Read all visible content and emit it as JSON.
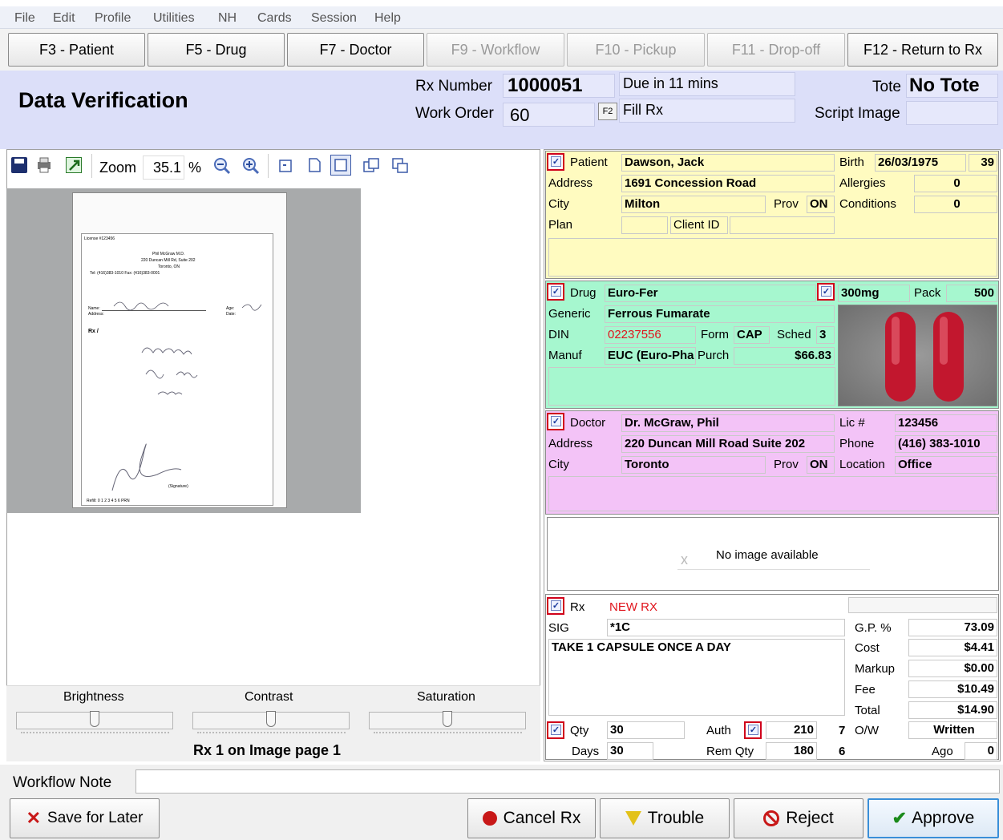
{
  "menu": [
    "File",
    "Edit",
    "Profile",
    "Utilities",
    "NH",
    "Cards",
    "Session",
    "Help"
  ],
  "fkeys": [
    {
      "label": "F3 - Patient",
      "enabled": true
    },
    {
      "label": "F5 - Drug",
      "enabled": true
    },
    {
      "label": "F7 - Doctor",
      "enabled": true
    },
    {
      "label": "F9 - Workflow",
      "enabled": false
    },
    {
      "label": "F10 - Pickup",
      "enabled": false
    },
    {
      "label": "F11 - Drop-off",
      "enabled": false
    },
    {
      "label": "F12 - Return to Rx",
      "enabled": true
    }
  ],
  "header": {
    "title": "Data Verification",
    "rx_number_label": "Rx Number",
    "rx_number": "1000051",
    "due": "Due in 11 mins",
    "tote_label": "Tote",
    "tote": "No Tote",
    "work_order_label": "Work Order",
    "work_order": "60",
    "f2": "F2",
    "fill_rx": "Fill Rx",
    "script_image_label": "Script Image"
  },
  "image_toolbar": {
    "zoom_label": "Zoom",
    "zoom_value": "35.1",
    "zoom_unit": "%"
  },
  "image_controls": {
    "brightness": "Brightness",
    "contrast": "Contrast",
    "saturation": "Saturation",
    "page_info": "Rx 1 on Image page 1"
  },
  "patient": {
    "label": "Patient",
    "name": "Dawson, Jack",
    "birth_label": "Birth",
    "birth": "26/03/1975",
    "age": "39",
    "address_label": "Address",
    "address": "1691 Concession Road",
    "allergies_label": "Allergies",
    "allergies": "0",
    "city_label": "City",
    "city": "Milton",
    "prov_label": "Prov",
    "prov": "ON",
    "conditions_label": "Conditions",
    "conditions": "0",
    "plan_label": "Plan",
    "client_id_label": "Client ID"
  },
  "drug": {
    "label": "Drug",
    "name": "Euro-Fer",
    "strength": "300mg",
    "pack_label": "Pack",
    "pack": "500",
    "generic_label": "Generic",
    "generic": "Ferrous Fumarate",
    "din_label": "DIN",
    "din": "02237556",
    "form_label": "Form",
    "form": "CAP",
    "sched_label": "Sched",
    "sched": "3",
    "manuf_label": "Manuf",
    "manuf": "EUC (Euro-Pha",
    "purch_label": "Purch",
    "purch": "$66.83"
  },
  "doctor": {
    "label": "Doctor",
    "name": "Dr. McGraw, Phil",
    "lic_label": "Lic #",
    "lic": "123456",
    "address_label": "Address",
    "address": "220 Duncan Mill Road Suite 202",
    "phone_label": "Phone",
    "phone": "(416) 383-1010",
    "city_label": "City",
    "city": "Toronto",
    "prov_label": "Prov",
    "prov": "ON",
    "location_label": "Location",
    "location": "Office",
    "no_image": "No image available",
    "no_image_x": "x"
  },
  "rx": {
    "label": "Rx",
    "status": "NEW RX",
    "sig_label": "SIG",
    "sig": "*1C",
    "sig_text": "TAKE 1 CAPSULE ONCE A DAY",
    "gp_label": "G.P. %",
    "gp": "73.09",
    "cost_label": "Cost",
    "cost": "$4.41",
    "markup_label": "Markup",
    "markup": "$0.00",
    "fee_label": "Fee",
    "fee": "$10.49",
    "total_label": "Total",
    "total": "$14.90",
    "qty_label": "Qty",
    "qty": "30",
    "auth_label": "Auth",
    "auth": "210",
    "auth_n": "7",
    "ow_label": "O/W",
    "ow": "Written",
    "days_label": "Days",
    "days": "30",
    "rem_qty_label": "Rem Qty",
    "rem_qty": "180",
    "rem_n": "6",
    "ago_label": "Ago",
    "ago": "0"
  },
  "workflow_note_label": "Workflow Note",
  "buttons": {
    "save": "Save for Later",
    "cancel": "Cancel Rx",
    "trouble": "Trouble",
    "reject": "Reject",
    "approve": "Approve"
  },
  "colors": {
    "header_bg": "#dcdff9",
    "patient_bg": "#fffbc0",
    "drug_bg": "#a6f7cf",
    "doctor_bg": "#f3c3f7",
    "rx_bg": "#ffffff",
    "checkbox_border": "#d0021b",
    "red_text": "#e0141c"
  },
  "script": {
    "license": "License #123456",
    "doctor": "Phil McGraw M.D.",
    "addr": "220 Duncan Mill Rd, Suite 202",
    "city": "Toronto, ON",
    "tel": "Tel: (416)383-1010     Fax: (416)383-0001",
    "name_label": "Name:",
    "address_label": "Address:",
    "age_label": "Age:",
    "date_label": "Date:",
    "rx": "Rx /",
    "refill": "Refill: 0 1 2 3 4 5 6 PRN",
    "signature": "(Signature)"
  }
}
